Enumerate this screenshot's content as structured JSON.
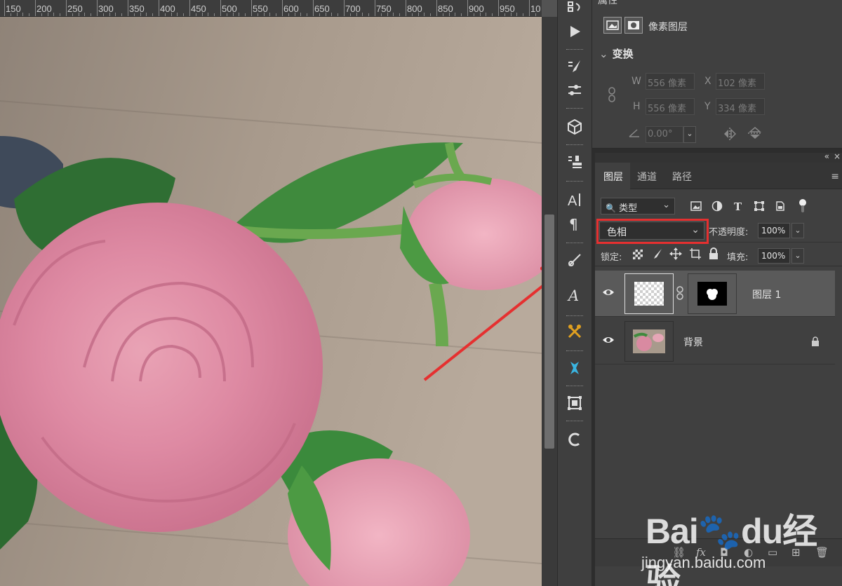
{
  "ruler": {
    "labels": [
      "150",
      "200",
      "250",
      "300",
      "350",
      "400",
      "450",
      "500",
      "550",
      "600",
      "650",
      "700",
      "750",
      "800",
      "850",
      "900",
      "950",
      "10"
    ]
  },
  "properties": {
    "tab_label": "属性",
    "layer_type": "像素图层",
    "section_title": "变换",
    "w_label": "W",
    "w_value": "556 像素",
    "x_label": "X",
    "x_value": "102 像素",
    "h_label": "H",
    "h_value": "556 像素",
    "y_label": "Y",
    "y_value": "334 像素",
    "angle_value": "0.00°"
  },
  "layers_panel": {
    "tabs": [
      "图层",
      "通道",
      "路径"
    ],
    "active_tab": "图层",
    "filter_kind": "类型",
    "blend_mode": "色相",
    "opacity_label": "不透明度:",
    "opacity_value": "100%",
    "lock_label": "锁定:",
    "fill_label": "填充:",
    "fill_value": "100%",
    "layers": [
      {
        "name": "图层 1",
        "selected": true,
        "has_mask": true,
        "visible": true,
        "locked": false
      },
      {
        "name": "背景",
        "selected": false,
        "has_mask": false,
        "visible": true,
        "locked": true
      }
    ],
    "bottom_icons": [
      "link-icon",
      "fx-icon",
      "mask-icon",
      "adjustment-icon",
      "folder-icon",
      "new-layer-icon",
      "trash-icon"
    ],
    "fx_label": "fx"
  },
  "watermark": {
    "logo": "Bai🐾du经验",
    "url": "jingyan.baidu.com"
  },
  "colors": {
    "highlight_box": "#e53030",
    "arrow": "#e53030"
  }
}
